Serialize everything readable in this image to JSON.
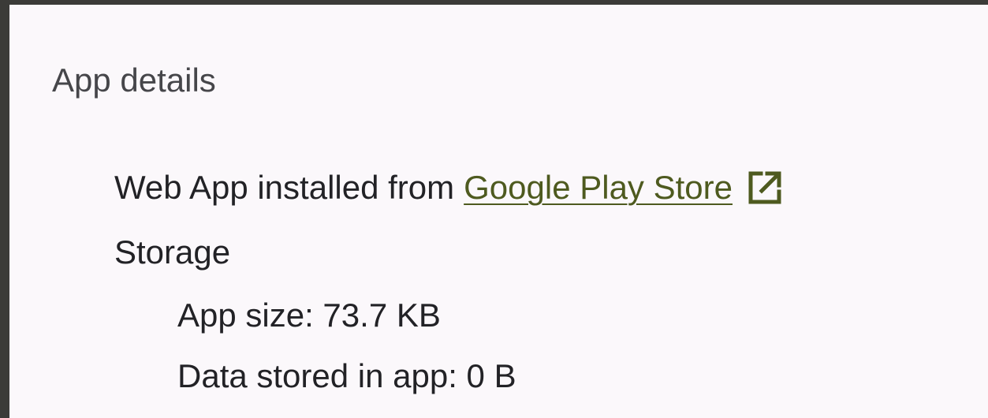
{
  "app_details": {
    "title": "App details",
    "installed_prefix": "Web App installed from",
    "installed_source_link": "Google Play Store",
    "open_icon": "open-in-new-icon",
    "storage_heading": "Storage",
    "app_size_label": "App size: 73.7 KB",
    "data_stored_label": "Data stored in app: 0 B"
  },
  "colors": {
    "panel_background": "#fbf8fb",
    "outer_background": "#3b3b38",
    "link_color": "#4e5a1f",
    "text_color": "#222226",
    "title_color": "#46464a"
  }
}
